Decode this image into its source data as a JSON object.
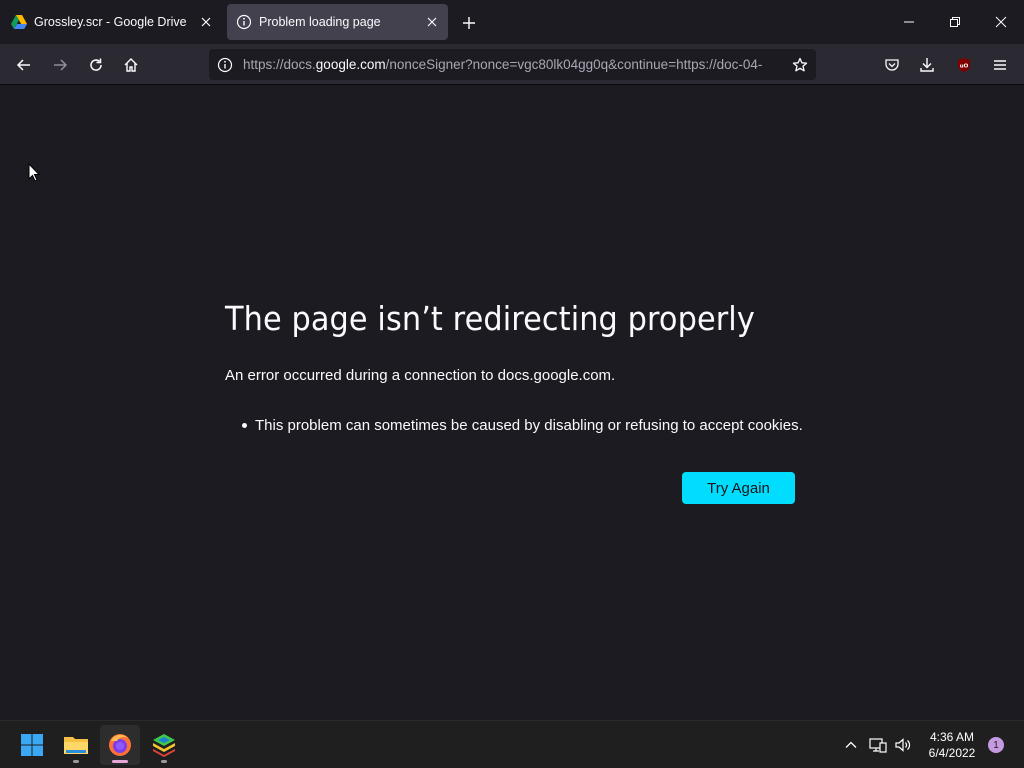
{
  "tabs": [
    {
      "title": "Grossley.scr - Google Drive",
      "icon": "google-drive-icon",
      "active": false
    },
    {
      "title": "Problem loading page",
      "icon": "info-icon",
      "active": true
    }
  ],
  "url": {
    "prefix": "https://docs.",
    "domain": "google.com",
    "suffix": "/nonceSigner?nonce=vgc80lk04gg0q&continue=https://doc-04-"
  },
  "error": {
    "title": "The page isn’t redirecting properly",
    "description": "An error occurred during a connection to docs.google.com.",
    "bullets": [
      "This problem can sometimes be caused by disabling or refusing to accept cookies."
    ],
    "button_label": "Try Again"
  },
  "taskbar": {
    "apps": [
      "start-icon",
      "file-explorer-icon",
      "firefox-icon",
      "bluestacks-icon"
    ],
    "time": "4:36 AM",
    "date": "6/4/2022",
    "notification_count": "1"
  },
  "colors": {
    "accent": "#00ddff",
    "background": "#1c1b22",
    "toolbar": "#2b2a33",
    "active_tab": "#42414d"
  }
}
